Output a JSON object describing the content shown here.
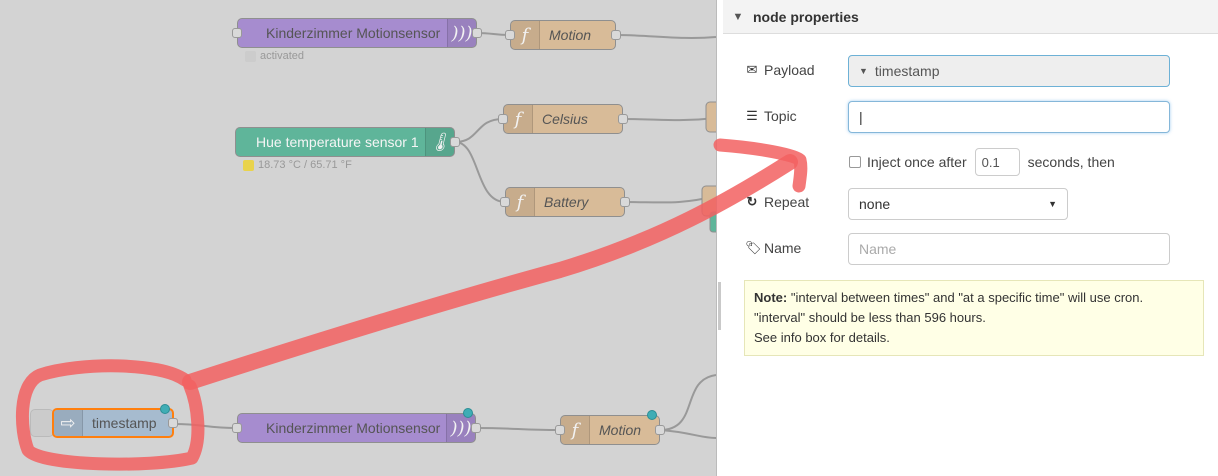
{
  "canvas": {
    "nodes": {
      "kinder_top": {
        "label": "Kinderzimmer Motionsensor",
        "status": "activated",
        "status_color": "#cccccc"
      },
      "motion_top": {
        "label": "Motion"
      },
      "celsius": {
        "label": "Celsius"
      },
      "hue_temp": {
        "label": "Hue temperature sensor 1",
        "status": "18.73 °C / 65.71 °F",
        "status_color": "#e9d34c"
      },
      "battery": {
        "label": "Battery"
      },
      "timestamp": {
        "label": "timestamp"
      },
      "kinder_bottom": {
        "label": "Kinderzimmer Motionsensor"
      },
      "motion_bottom": {
        "label": "Motion"
      }
    },
    "colors": {
      "motion_sensor_node": "#a68ccf",
      "function_node": "#d8bb98",
      "temperature_node": "#5fb59a",
      "inject_node": "#a6bbcf",
      "annotation": "#f26060",
      "changed_badge": "#3fadb5"
    }
  },
  "sidebar": {
    "section_title": "node properties",
    "payload": {
      "label": "Payload",
      "icon": "envelope-icon",
      "value": "timestamp"
    },
    "topic": {
      "label": "Topic",
      "icon": "list-icon",
      "value": "|"
    },
    "inject": {
      "label": "Inject once after",
      "value": "0.1",
      "suffix": "seconds, then"
    },
    "repeat": {
      "label": "Repeat",
      "icon": "repeat-icon",
      "value": "none",
      "options": [
        "none"
      ]
    },
    "name": {
      "label": "Name",
      "icon": "tag-icon",
      "placeholder": "Name"
    },
    "note": {
      "bold": "Note:",
      "line1": " \"interval between times\" and \"at a specific time\" will use cron.",
      "line2": "\"interval\" should be less than 596 hours.",
      "line3": "See info box for details."
    }
  }
}
